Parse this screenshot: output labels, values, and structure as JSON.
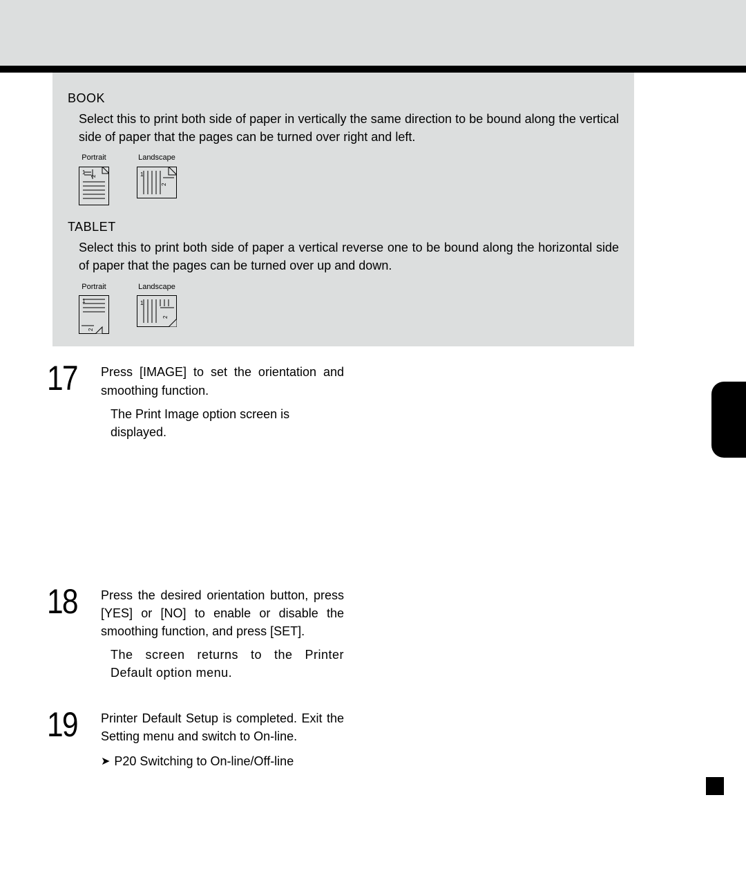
{
  "box": {
    "book": {
      "title": "BOOK",
      "desc": "Select this to print both side of paper in vertically the same direction to be bound along the vertical side of paper that the pages can be turned over right and left.",
      "portrait_label": "Portrait",
      "landscape_label": "Landscape"
    },
    "tablet": {
      "title": "TABLET",
      "desc": "Select this to print both side of paper a vertical reverse one to be bound along the horizontal side of paper that the pages can be turned over up and down.",
      "portrait_label": "Portrait",
      "landscape_label": "Landscape"
    }
  },
  "steps": {
    "s17": {
      "num": "17",
      "title": "Press [IMAGE] to set the orientation and smoothing function.",
      "sub": "The Print Image option screen is displayed."
    },
    "s18": {
      "num": "18",
      "title": "Press the desired orientation button, press [YES] or [NO] to enable or disable the smoothing function, and press [SET].",
      "sub": "The screen returns to the Printer Default option menu."
    },
    "s19": {
      "num": "19",
      "title": "Printer Default Setup is completed.  Exit the Setting menu and switch to On-line.",
      "ref_arrow": "➤",
      "ref": "P20  Switching to On-line/Off-line"
    }
  }
}
